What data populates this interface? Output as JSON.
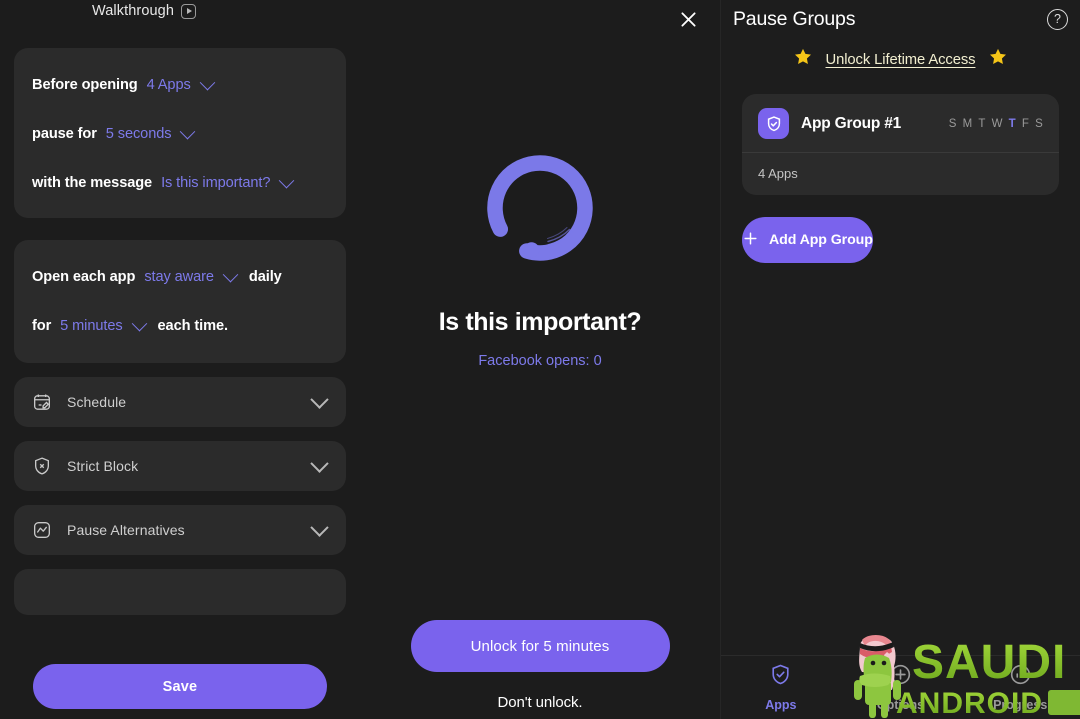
{
  "theme": {
    "page_bg": "#1c1c1c",
    "card_bg": "#2b2b2b",
    "accent_purple": "#7a63ed",
    "value_purple": "#7d7aea",
    "gold": "#f5c518",
    "lifetime_text": "#f2efd0",
    "watermark_green": "#8dc63f"
  },
  "left_panel": {
    "walkthrough": {
      "label": "Walkthrough",
      "icon": "play-badge-icon"
    },
    "settings_card_1": {
      "rows": [
        {
          "static_before": "Before opening",
          "value": "4 Apps",
          "static_after": "",
          "chevron": "chevron-down-icon"
        },
        {
          "static_before": "pause for",
          "value": "5 seconds",
          "static_after": "",
          "chevron": "chevron-down-icon"
        },
        {
          "static_before": "with the message",
          "value": "Is this important?",
          "static_after": "",
          "chevron": "chevron-down-icon"
        }
      ]
    },
    "settings_card_2": {
      "rows": [
        {
          "static_before": "Open each app",
          "value": "stay aware",
          "static_after": "daily",
          "chevron": "chevron-down-icon"
        },
        {
          "static_before": "for",
          "value": "5 minutes",
          "static_after": "each time.",
          "chevron": "chevron-down-icon"
        }
      ]
    },
    "collapsibles": [
      {
        "label": "Schedule",
        "icon": "calendar-edit-icon"
      },
      {
        "label": "Strict Block",
        "icon": "shield-x-icon"
      },
      {
        "label": "Pause Alternatives",
        "icon": "wave-square-icon"
      }
    ],
    "save_button": "Save"
  },
  "center_panel": {
    "close_icon": "close-icon",
    "logo_icon": "enso-circle-logo",
    "title": "Is this important?",
    "subtitle": "Facebook opens: 0",
    "unlock_button": "Unlock for 5 minutes",
    "dont_unlock": "Don't unlock."
  },
  "right_panel": {
    "title": "Pause Groups",
    "help_icon": "help-circle-icon",
    "help_glyph": "?",
    "lifetime": {
      "label": "Unlock Lifetime Access",
      "star_left": "star-icon",
      "star_right": "star-icon"
    },
    "groups": [
      {
        "name": "App Group #1",
        "avatar_icon": "shield-check-icon",
        "days": [
          {
            "letter": "S",
            "active": false
          },
          {
            "letter": "M",
            "active": false
          },
          {
            "letter": "T",
            "active": false
          },
          {
            "letter": "W",
            "active": false
          },
          {
            "letter": "T",
            "active": true
          },
          {
            "letter": "F",
            "active": false
          },
          {
            "letter": "S",
            "active": false
          }
        ],
        "apps_count": "4 Apps"
      }
    ],
    "add_group_button": "Add App Group",
    "add_group_icon": "plus-icon",
    "bottom_nav": [
      {
        "label": "Apps",
        "icon": "shield-check-icon",
        "active": true
      },
      {
        "label": "Options",
        "icon": "sliders-icon",
        "active": false
      },
      {
        "label": "Progress",
        "icon": "chart-circle-icon",
        "active": false
      }
    ]
  },
  "watermark": {
    "line1": "SAUDI",
    "line2": "ANDROID",
    "mascot": "android-mascot-keffiyeh-icon"
  }
}
